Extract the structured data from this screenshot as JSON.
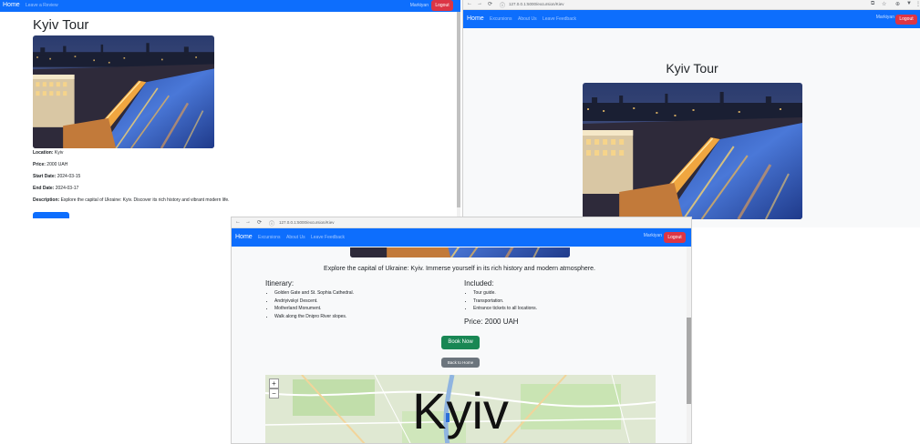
{
  "window_left": {
    "nav": {
      "brand": "Home",
      "links": [
        "Leave a Review"
      ],
      "user": "Markiyan",
      "logout": "Logout"
    },
    "title": "Kyiv Tour",
    "details": [
      {
        "label": "Location:",
        "value": "Kyiv"
      },
      {
        "label": "Price:",
        "value": "2000 UAH"
      },
      {
        "label": "Start Date:",
        "value": "2024-03-15"
      },
      {
        "label": "End Date:",
        "value": "2024-03-17"
      },
      {
        "label": "Description:",
        "value": "Explore the capital of Ukraine: Kyiv. Discover its rich history and vibrant modern life."
      }
    ]
  },
  "window_right": {
    "url": "127.0.0.1:5000/excursion/Kiev",
    "nav": {
      "brand": "Home",
      "links": [
        "Excursions",
        "About Us",
        "Leave Feedback"
      ],
      "user": "Markiyan",
      "logout": "Logout"
    },
    "title": "Kyiv Tour"
  },
  "window_bottom": {
    "url": "127.0.0.1:5000/excursion/Kiev",
    "nav": {
      "brand": "Home",
      "links": [
        "Excursions",
        "About Us",
        "Leave Feedback"
      ],
      "user": "Markiyan",
      "logout": "Logout"
    },
    "intro": "Explore the capital of Ukraine: Kyiv. Immerse yourself in its rich history and modern atmosphere.",
    "itinerary": {
      "heading": "Itinerary:",
      "items": [
        "Golden Gate and St. Sophia Cathedral.",
        "Andriyivskyi Descent.",
        "Motherland Monument.",
        "Walk along the Dnipro River slopes."
      ]
    },
    "included": {
      "heading": "Included:",
      "items": [
        "Tour guide.",
        "Transportation.",
        "Entrance tickets to all locations."
      ]
    },
    "price": "Price: 2000 UAH",
    "book_button": "Book Now",
    "back_button": "Back to Home",
    "map": {
      "label": "Kyiv",
      "zoom_in": "+",
      "zoom_out": "−"
    }
  },
  "colors": {
    "navbar": "#0d6efd",
    "logout": "#dc3545",
    "book": "#198754",
    "back": "#6c757d"
  }
}
